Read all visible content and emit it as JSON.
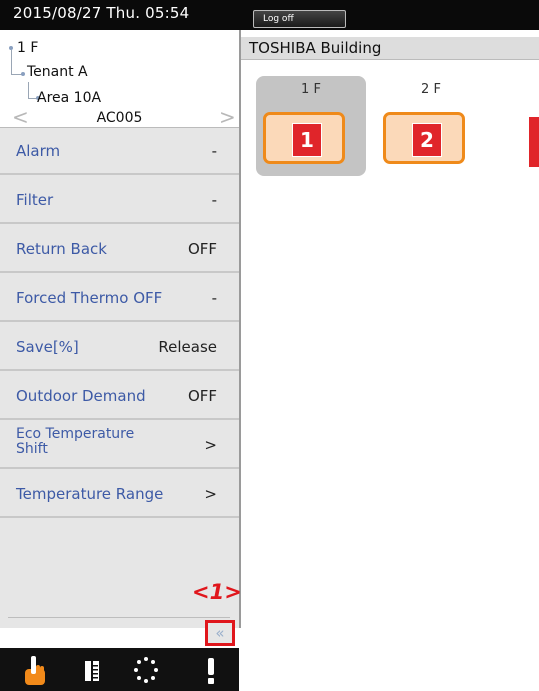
{
  "header": {
    "datetime": "2015/08/27  Thu.  05:54",
    "logoff_label": "Log off"
  },
  "tree": {
    "floor": "1 F",
    "tenant": "Tenant A",
    "area": "Area 10A"
  },
  "unit": {
    "name": "AC005",
    "prev_icon": "chevron-left-icon",
    "next_icon": "chevron-right-icon"
  },
  "menu": [
    {
      "label": "Alarm",
      "value": "-"
    },
    {
      "label": "Filter",
      "value": "-"
    },
    {
      "label": "Return Back",
      "value": "OFF"
    },
    {
      "label": "Forced Thermo OFF",
      "value": "-"
    },
    {
      "label": "Save[%]",
      "value": "Release"
    },
    {
      "label": "Outdoor Demand",
      "value": "OFF"
    },
    {
      "label": "Eco Temperature Shift",
      "value": ">"
    },
    {
      "label": "Temperature Range",
      "value": ">"
    }
  ],
  "annotation": {
    "label": "<1>",
    "collapse_icon": "«"
  },
  "bottom_nav": [
    "hand-pointer-icon",
    "list-icon",
    "loading-circle-icon",
    "exclamation-icon"
  ],
  "building": {
    "title": "TOSHIBA Building",
    "floors": [
      {
        "label": "1 F",
        "number": "1",
        "selected": true
      },
      {
        "label": "2 F",
        "number": "2",
        "selected": false
      }
    ]
  },
  "colors": {
    "menu_label": "#3d5aa6",
    "highlight": "#e0161c",
    "floor_border": "#ef8a1a",
    "floor_fill": "#fbd9b9",
    "badge": "#e0252a"
  }
}
